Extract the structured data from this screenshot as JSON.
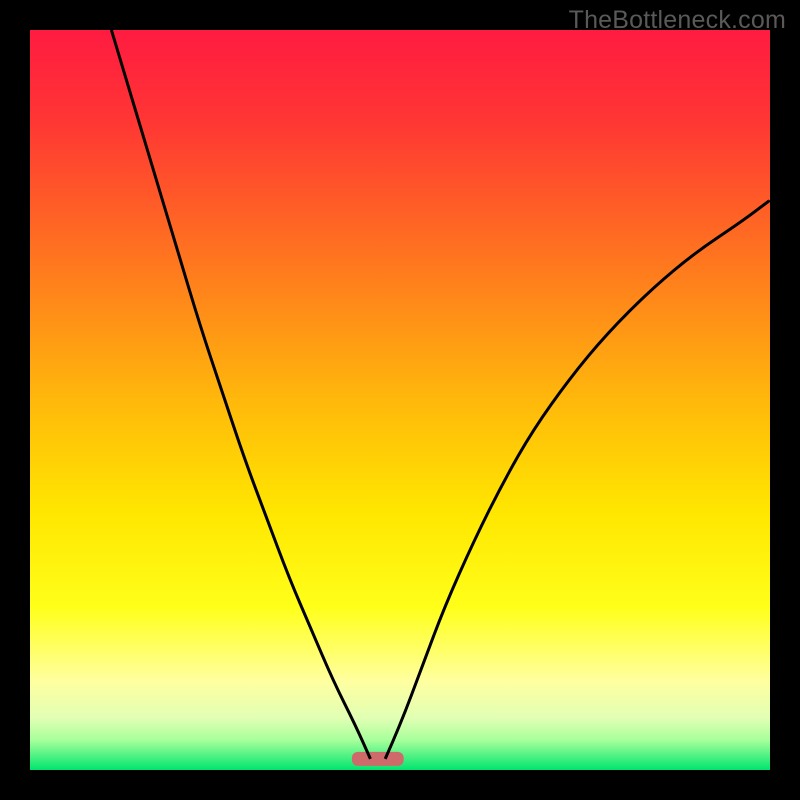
{
  "watermark": "TheBottleneck.com",
  "chart_data": {
    "type": "line",
    "title": "",
    "xlabel": "",
    "ylabel": "",
    "xlim": [
      0,
      100
    ],
    "ylim": [
      0,
      100
    ],
    "background_gradient_stops": [
      {
        "pos": 0.0,
        "color": "#ff1b41"
      },
      {
        "pos": 0.12,
        "color": "#ff3534"
      },
      {
        "pos": 0.3,
        "color": "#ff7220"
      },
      {
        "pos": 0.5,
        "color": "#ffb80b"
      },
      {
        "pos": 0.65,
        "color": "#ffe600"
      },
      {
        "pos": 0.78,
        "color": "#ffff1a"
      },
      {
        "pos": 0.88,
        "color": "#ffffa0"
      },
      {
        "pos": 0.93,
        "color": "#e1ffb4"
      },
      {
        "pos": 0.96,
        "color": "#a6ff9a"
      },
      {
        "pos": 1.0,
        "color": "#00e56f"
      }
    ],
    "marker": {
      "x_start": 43.5,
      "x_end": 50.5,
      "y": 1.5,
      "color": "#cf6a6a",
      "rx": 1.5
    },
    "series": [
      {
        "name": "left-curve",
        "x": [
          11,
          14,
          17,
          20,
          23,
          26,
          29,
          32,
          35,
          38,
          41,
          44,
          46
        ],
        "y": [
          100,
          90,
          80,
          70,
          60,
          51,
          42,
          34,
          26,
          19,
          12,
          6,
          1.5
        ]
      },
      {
        "name": "right-curve",
        "x": [
          48,
          50,
          53,
          56,
          60,
          64,
          68,
          73,
          78,
          84,
          90,
          96,
          100
        ],
        "y": [
          1.5,
          6,
          14,
          22,
          31,
          39,
          46,
          53,
          59,
          65,
          70,
          74,
          77
        ]
      }
    ]
  }
}
